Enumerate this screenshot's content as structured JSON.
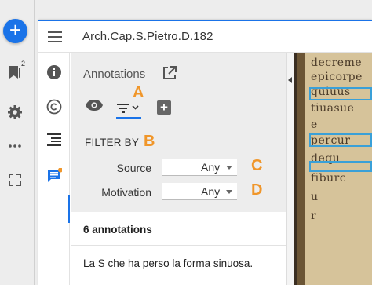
{
  "window": {
    "title": "Arch.Cap.S.Pietro.D.182"
  },
  "rail": {
    "add_label": "+",
    "badge": "2"
  },
  "panel": {
    "heading": "Annotations",
    "filter_by": "FILTER BY",
    "rows": [
      {
        "label": "Source",
        "value": "Any"
      },
      {
        "label": "Motivation",
        "value": "Any"
      }
    ],
    "count": "6 annotations",
    "first_annotation": "La S che ha perso la forma sinuosa."
  },
  "callouts": {
    "a": "A",
    "b": "B",
    "c": "C",
    "d": "D"
  },
  "manuscript": {
    "lines": [
      "decreme",
      "epicorpe",
      "quiuus",
      "tiuasue",
      "e",
      "percur",
      "dequ",
      "fiburc",
      "u",
      "r"
    ]
  },
  "colors": {
    "accent": "#1a73e8",
    "callout": "#f0962a",
    "highlight": "#3aa0d8"
  }
}
